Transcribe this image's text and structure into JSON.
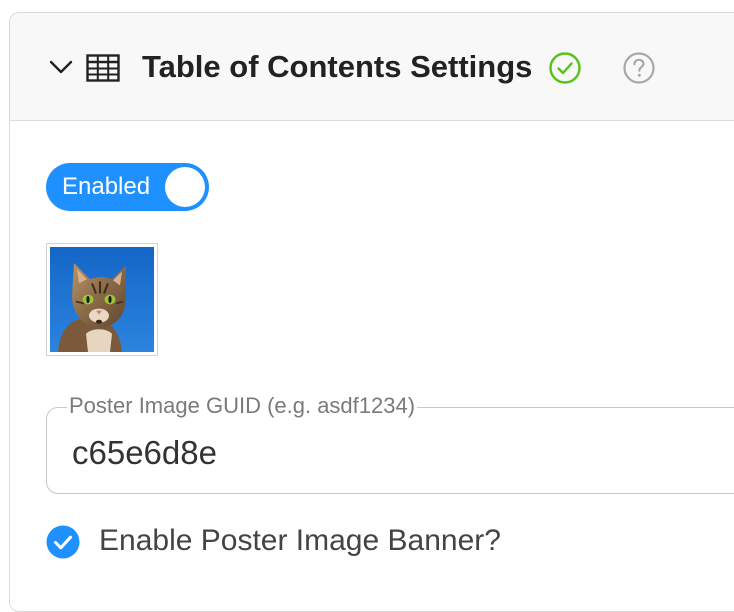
{
  "panel": {
    "title": "Table of Contents Settings",
    "icons": {
      "collapse": "chevron-down-icon",
      "section": "table-icon",
      "status": "check-circle-icon",
      "help": "help-circle-icon"
    },
    "status_color": "#52c41a"
  },
  "toggle": {
    "label": "Enabled",
    "on": true,
    "color": "#1e90ff"
  },
  "poster_image": {
    "subject": "cat photo on blue background"
  },
  "guid_field": {
    "label": "Poster Image GUID (e.g. asdf1234)",
    "value": "c65e6d8e"
  },
  "banner_checkbox": {
    "label": "Enable Poster Image Banner?",
    "checked": true,
    "color": "#1e90ff"
  }
}
